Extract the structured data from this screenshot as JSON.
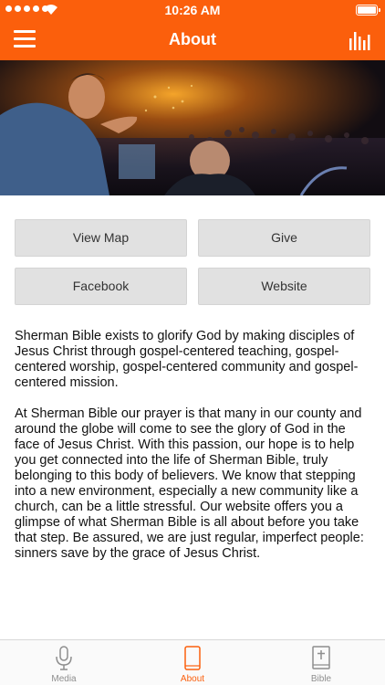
{
  "status_bar": {
    "time": "10:26 AM"
  },
  "nav": {
    "title": "About",
    "menu_icon": "hamburger-menu-icon",
    "right_icon": "bar-chart-icon"
  },
  "colors": {
    "accent": "#fb5f0c",
    "button_bg": "#e1e1e1",
    "tab_inactive": "#8e8e8e"
  },
  "buttons": {
    "view_map": "View Map",
    "give": "Give",
    "facebook": "Facebook",
    "website": "Website"
  },
  "content": {
    "paragraph_1": "Sherman Bible exists to glorify God by making disciples of Jesus Christ through gospel-centered teaching, gospel-centered worship, gospel-centered community and gospel-centered mission.",
    "paragraph_2": "At Sherman Bible our prayer is that many in our county and around the globe will come to see the glory of God in the face of Jesus Christ. With this passion, our hope is to help you get connected into the life of Sherman Bible, truly belonging to this body of believers. We know that stepping into a new environment, especially a new community like a church, can be a little stressful. Our website offers you a glimpse of what Sherman Bible is all about before you take that step. Be assured, we are just regular, imperfect people: sinners save by the grace of Jesus Christ."
  },
  "tabs": [
    {
      "label": "Media",
      "icon": "microphone-icon",
      "active": false
    },
    {
      "label": "About",
      "icon": "tablet-icon",
      "active": true
    },
    {
      "label": "Bible",
      "icon": "bible-book-icon",
      "active": false
    }
  ]
}
